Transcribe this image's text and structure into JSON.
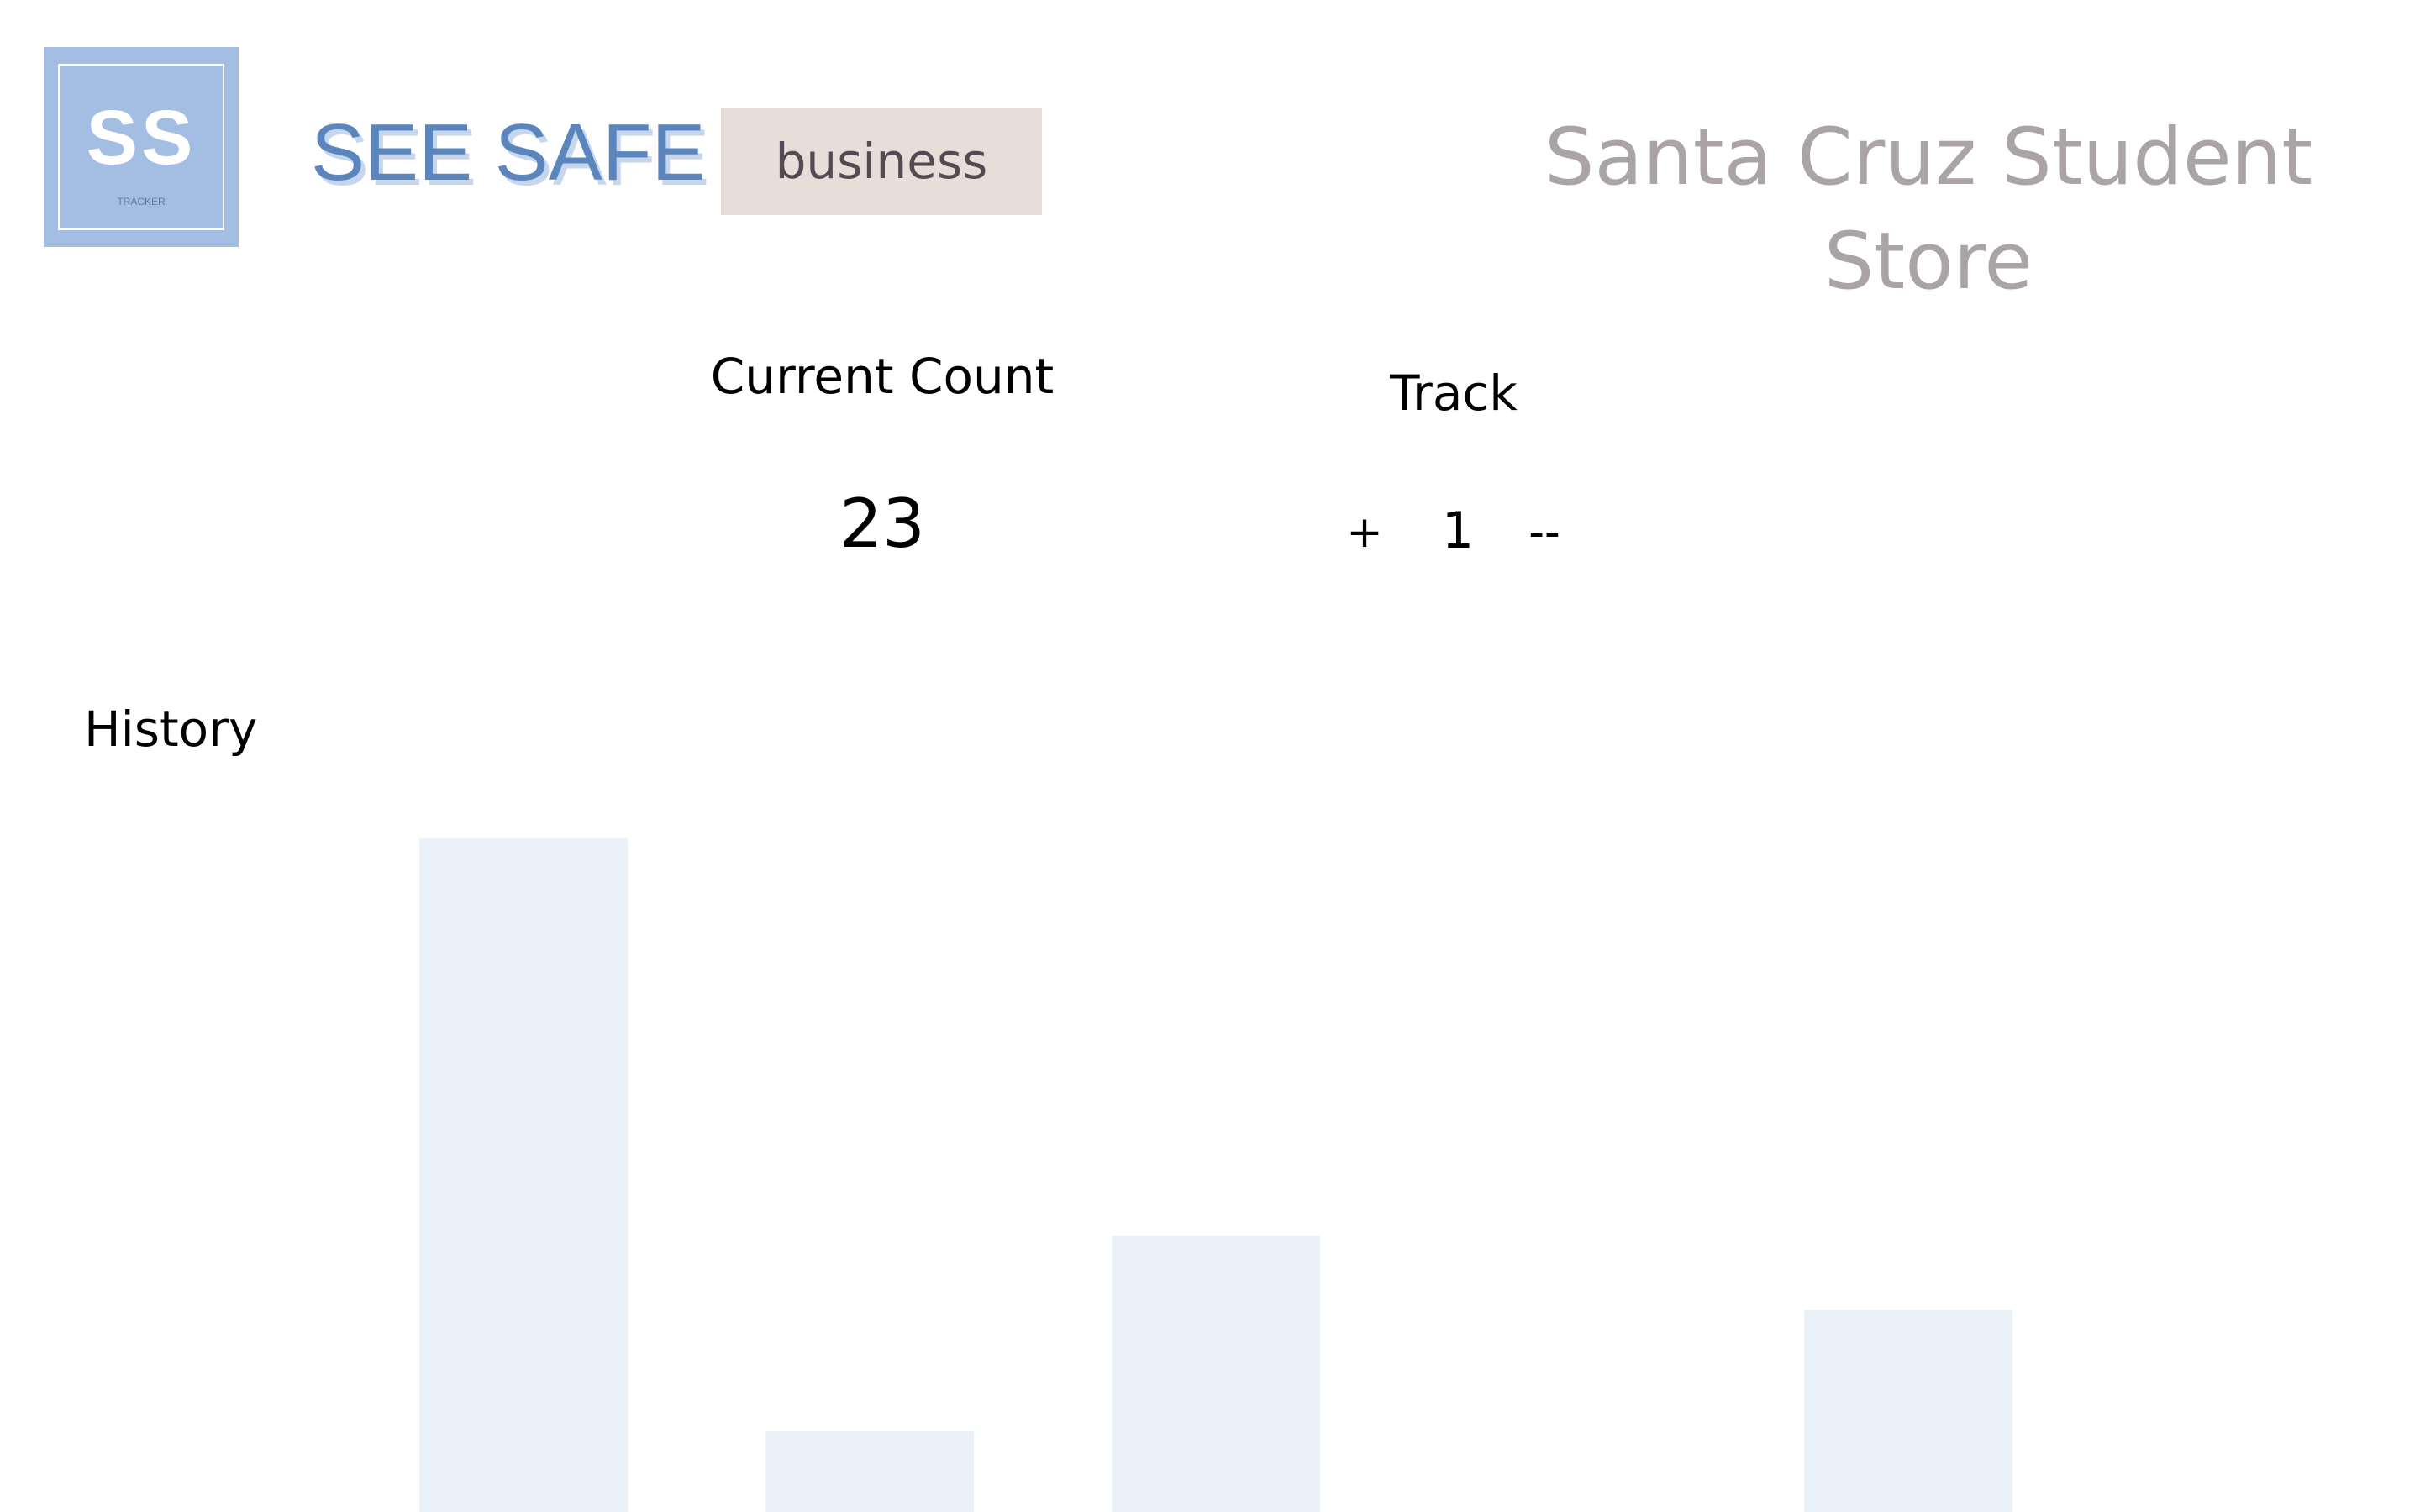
{
  "logo": {
    "letters": "SS",
    "subtitle": "TRACKER",
    "color": "#a3bde3"
  },
  "brand": {
    "name": "SEE SAFE",
    "color": "#5b86bd"
  },
  "mode_button": {
    "label": "business",
    "background": "#e8ddd8"
  },
  "store": {
    "name": "Santa Cruz Student Store"
  },
  "current_count": {
    "label": "Current Count",
    "value": "23"
  },
  "track": {
    "label": "Track",
    "increment_label": "+",
    "step_value": "1",
    "decrement_label": "--"
  },
  "history": {
    "label": "History"
  },
  "chart_data": {
    "type": "bar",
    "bar_color": "#ebf1f9",
    "ylim": [
      0,
      100
    ],
    "values": [
      100,
      12,
      41,
      0,
      30
    ]
  }
}
